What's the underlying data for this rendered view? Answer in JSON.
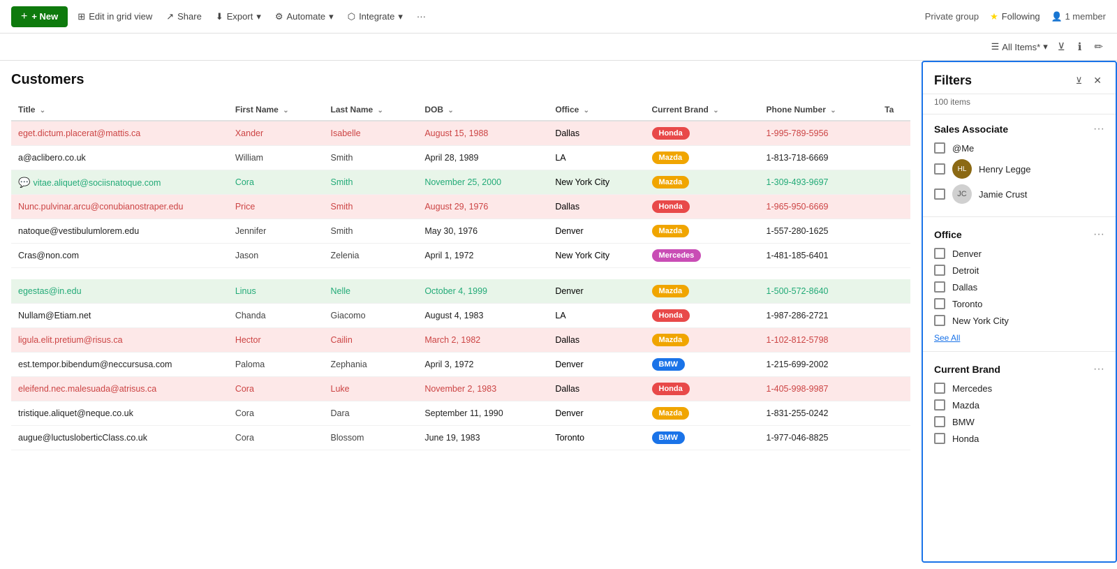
{
  "topbar": {
    "new_label": "+ New",
    "edit_grid_label": "Edit in grid view",
    "share_label": "Share",
    "export_label": "Export",
    "automate_label": "Automate",
    "integrate_label": "Integrate",
    "more_label": "···",
    "private_group_label": "Private group",
    "following_label": "Following",
    "members_label": "1 member"
  },
  "items_bar": {
    "all_items_label": "All Items*"
  },
  "page": {
    "title": "Customers"
  },
  "table": {
    "columns": [
      "Title",
      "First Name",
      "Last Name",
      "DOB",
      "Office",
      "Current Brand",
      "Phone Number",
      "Ta"
    ],
    "rows": [
      {
        "title": "eget.dictum.placerat@mattis.ca",
        "firstName": "Xander",
        "lastName": "Isabelle",
        "dob": "August 15, 1988",
        "office": "Dallas",
        "brand": "Honda",
        "phone": "1-995-789-5956",
        "rowType": "pink",
        "hasChat": false
      },
      {
        "title": "a@aclibero.co.uk",
        "firstName": "William",
        "lastName": "Smith",
        "dob": "April 28, 1989",
        "office": "LA",
        "brand": "Mazda",
        "phone": "1-813-718-6669",
        "rowType": "white",
        "hasChat": false
      },
      {
        "title": "vitae.aliquet@sociisnatoque.com",
        "firstName": "Cora",
        "lastName": "Smith",
        "dob": "November 25, 2000",
        "office": "New York City",
        "brand": "Mazda",
        "phone": "1-309-493-9697",
        "rowType": "green",
        "hasChat": true
      },
      {
        "title": "Nunc.pulvinar.arcu@conubianostraper.edu",
        "firstName": "Price",
        "lastName": "Smith",
        "dob": "August 29, 1976",
        "office": "Dallas",
        "brand": "Honda",
        "phone": "1-965-950-6669",
        "rowType": "pink",
        "hasChat": false
      },
      {
        "title": "natoque@vestibulumlorem.edu",
        "firstName": "Jennifer",
        "lastName": "Smith",
        "dob": "May 30, 1976",
        "office": "Denver",
        "brand": "Mazda",
        "phone": "1-557-280-1625",
        "rowType": "white",
        "hasChat": false
      },
      {
        "title": "Cras@non.com",
        "firstName": "Jason",
        "lastName": "Zelenia",
        "dob": "April 1, 1972",
        "office": "New York City",
        "brand": "Mercedes",
        "phone": "1-481-185-6401",
        "rowType": "white",
        "hasChat": false
      },
      {
        "title": "",
        "firstName": "",
        "lastName": "",
        "dob": "",
        "office": "",
        "brand": "",
        "phone": "",
        "rowType": "white",
        "hasChat": false
      },
      {
        "title": "egestas@in.edu",
        "firstName": "Linus",
        "lastName": "Nelle",
        "dob": "October 4, 1999",
        "office": "Denver",
        "brand": "Mazda",
        "phone": "1-500-572-8640",
        "rowType": "green",
        "hasChat": false
      },
      {
        "title": "Nullam@Etiam.net",
        "firstName": "Chanda",
        "lastName": "Giacomo",
        "dob": "August 4, 1983",
        "office": "LA",
        "brand": "Honda",
        "phone": "1-987-286-2721",
        "rowType": "white",
        "hasChat": false
      },
      {
        "title": "ligula.elit.pretium@risus.ca",
        "firstName": "Hector",
        "lastName": "Cailin",
        "dob": "March 2, 1982",
        "office": "Dallas",
        "brand": "Mazda",
        "phone": "1-102-812-5798",
        "rowType": "pink",
        "hasChat": false
      },
      {
        "title": "est.tempor.bibendum@neccursusa.com",
        "firstName": "Paloma",
        "lastName": "Zephania",
        "dob": "April 3, 1972",
        "office": "Denver",
        "brand": "BMW",
        "phone": "1-215-699-2002",
        "rowType": "white",
        "hasChat": false
      },
      {
        "title": "eleifend.nec.malesuada@atrisus.ca",
        "firstName": "Cora",
        "lastName": "Luke",
        "dob": "November 2, 1983",
        "office": "Dallas",
        "brand": "Honda",
        "phone": "1-405-998-9987",
        "rowType": "pink",
        "hasChat": false
      },
      {
        "title": "tristique.aliquet@neque.co.uk",
        "firstName": "Cora",
        "lastName": "Dara",
        "dob": "September 11, 1990",
        "office": "Denver",
        "brand": "Mazda",
        "phone": "1-831-255-0242",
        "rowType": "white",
        "hasChat": false
      },
      {
        "title": "augue@luctusloberticClass.co.uk",
        "firstName": "Cora",
        "lastName": "Blossom",
        "dob": "June 19, 1983",
        "office": "Toronto",
        "brand": "BMW",
        "phone": "1-977-046-8825",
        "rowType": "white",
        "hasChat": false
      }
    ]
  },
  "filters": {
    "title": "Filters",
    "count": "100 items",
    "sections": [
      {
        "title": "Sales Associate",
        "items": [
          {
            "label": "@Me",
            "hasAvatar": false,
            "isMe": true
          },
          {
            "label": "Henry Legge",
            "hasAvatar": true,
            "isMe": false
          },
          {
            "label": "Jamie Crust",
            "hasAvatar": true,
            "isMe": false
          }
        ]
      },
      {
        "title": "Office",
        "items": [
          {
            "label": "Denver"
          },
          {
            "label": "Detroit"
          },
          {
            "label": "Dallas"
          },
          {
            "label": "Toronto"
          },
          {
            "label": "New York City"
          }
        ],
        "hasSeeAll": true
      },
      {
        "title": "Current Brand",
        "items": [
          {
            "label": "Mercedes"
          },
          {
            "label": "Mazda"
          },
          {
            "label": "BMW"
          },
          {
            "label": "Honda"
          }
        ]
      }
    ]
  }
}
